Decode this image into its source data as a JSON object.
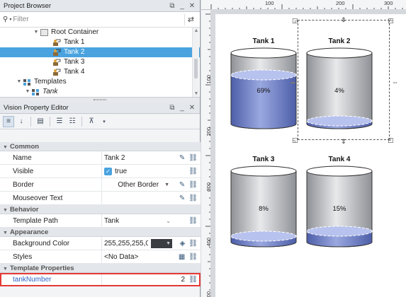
{
  "project_browser": {
    "title": "Project Browser",
    "filter_placeholder": "Filter",
    "tree": [
      {
        "label": "Root Container",
        "indent": 3,
        "twisty": "▼",
        "icon": "container",
        "selected": false
      },
      {
        "label": "Tank 1",
        "indent": 5,
        "twisty": "",
        "icon": "tank",
        "selected": false
      },
      {
        "label": "Tank 2",
        "indent": 5,
        "twisty": "",
        "icon": "tank",
        "selected": true
      },
      {
        "label": "Tank 3",
        "indent": 5,
        "twisty": "",
        "icon": "tank",
        "selected": false
      },
      {
        "label": "Tank 4",
        "indent": 5,
        "twisty": "",
        "icon": "tank",
        "selected": false
      },
      {
        "label": "Templates",
        "indent": 1,
        "twisty": "▼",
        "icon": "templates",
        "selected": false
      },
      {
        "label": "Tank",
        "indent": 2,
        "twisty": "▼",
        "icon": "templates",
        "selected": false,
        "italic": true
      }
    ]
  },
  "property_editor": {
    "title": "Vision Property Editor",
    "categories": [
      {
        "name": "Common",
        "rows": [
          {
            "name": "Name",
            "value": "Tank 2",
            "actions": "✎ ⛓"
          },
          {
            "name": "Visible",
            "value": "true",
            "checkbox": true,
            "actions": "⛓"
          },
          {
            "name": "Border",
            "value": "Other Border",
            "dropdown": true,
            "actions": "✎ ⛓"
          },
          {
            "name": "Mouseover Text",
            "value": "",
            "actions": "✎ ⛓"
          }
        ]
      },
      {
        "name": "Behavior",
        "rows": [
          {
            "name": "Template Path",
            "value": "Tank",
            "chevron": true,
            "actions": "⛓"
          }
        ]
      },
      {
        "name": "Appearance",
        "rows": [
          {
            "name": "Background Color",
            "value": "255,255,255,0",
            "swatch": true,
            "actions": "◈ ⛓"
          },
          {
            "name": "Styles",
            "value": "<No Data>",
            "actions": "▦ ⛓"
          }
        ]
      },
      {
        "name": "Template Properties",
        "rows": [
          {
            "name": "tankNumber",
            "value": "2",
            "align_right": true,
            "highlight": true,
            "actions": "⛓"
          }
        ]
      }
    ]
  },
  "ruler": {
    "top_labels": [
      "100",
      "200",
      "300"
    ],
    "left_labels": [
      "100",
      "200",
      "300",
      "400",
      "500"
    ]
  },
  "tanks": [
    {
      "title": "Tank 1",
      "level": 0.69,
      "label": "69%"
    },
    {
      "title": "Tank 2",
      "level": 0.04,
      "label": "4%"
    },
    {
      "title": "Tank 3",
      "level": 0.08,
      "label": "8%"
    },
    {
      "title": "Tank 4",
      "level": 0.15,
      "label": "15%"
    }
  ],
  "colors": {
    "selection": "#4aa3df",
    "liquid": "#6f82c9",
    "liquid_top": "#b8c2ee",
    "highlight_border": "#e53935"
  }
}
